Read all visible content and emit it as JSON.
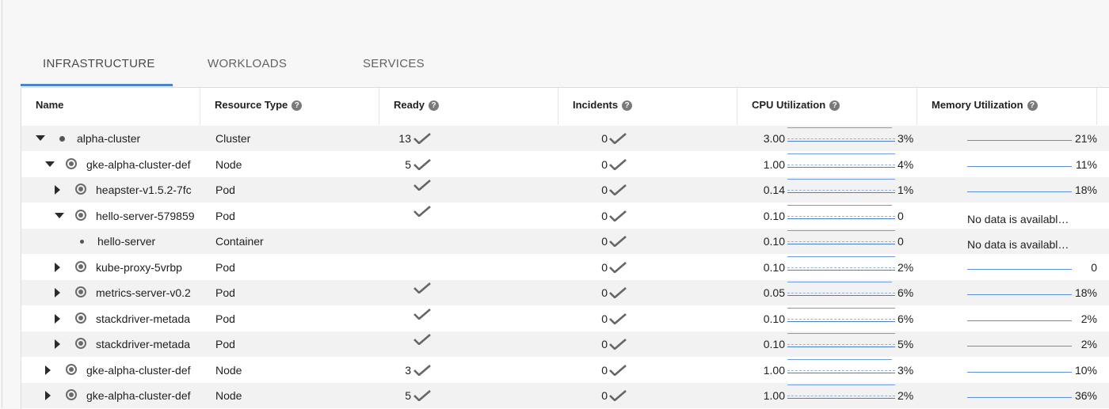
{
  "tabs": [
    {
      "label": "INFRASTRUCTURE",
      "active": true
    },
    {
      "label": "WORKLOADS",
      "active": false
    },
    {
      "label": "SERVICES",
      "active": false
    }
  ],
  "columns": {
    "name": "Name",
    "resource_type": "Resource Type",
    "ready": "Ready",
    "incidents": "Incidents",
    "cpu": "CPU Utilization",
    "memory": "Memory Utilization"
  },
  "rows": [
    {
      "name": "alpha-cluster",
      "type": "Cluster",
      "ready": "13",
      "ready_check": true,
      "incidents": "0",
      "cpu_value": "3.00",
      "cpu_pct": "3%",
      "mem": "21%",
      "level": 0,
      "expander": "down",
      "icon": "dot"
    },
    {
      "name": "gke-alpha-cluster-def",
      "type": "Node",
      "ready": "5",
      "ready_check": true,
      "incidents": "0",
      "cpu_value": "1.00",
      "cpu_pct": "4%",
      "mem": "11%",
      "level": 1,
      "expander": "down",
      "icon": "ring"
    },
    {
      "name": "heapster-v1.5.2-7fc",
      "type": "Pod",
      "ready": "",
      "ready_check": true,
      "incidents": "0",
      "cpu_value": "0.14",
      "cpu_pct": "1%",
      "mem": "18%",
      "level": 2,
      "expander": "right",
      "icon": "ring"
    },
    {
      "name": "hello-server-579859",
      "type": "Pod",
      "ready": "",
      "ready_check": true,
      "incidents": "0",
      "cpu_value": "0.10",
      "cpu_pct": "0",
      "mem": "No data is availabl…",
      "level": 2,
      "expander": "down",
      "icon": "ring"
    },
    {
      "name": "hello-server",
      "type": "Container",
      "ready": "",
      "ready_check": false,
      "incidents": "0",
      "cpu_value": "0.10",
      "cpu_pct": "0",
      "mem": "No data is availabl…",
      "level": 3,
      "expander": "",
      "icon": "small-dot"
    },
    {
      "name": "kube-proxy-5vrbp",
      "type": "Pod",
      "ready": "",
      "ready_check": false,
      "incidents": "0",
      "cpu_value": "0.10",
      "cpu_pct": "2%",
      "mem": "0",
      "level": 2,
      "expander": "right",
      "icon": "ring"
    },
    {
      "name": "metrics-server-v0.2",
      "type": "Pod",
      "ready": "",
      "ready_check": true,
      "incidents": "0",
      "cpu_value": "0.05",
      "cpu_pct": "6%",
      "mem": "18%",
      "level": 2,
      "expander": "right",
      "icon": "ring"
    },
    {
      "name": "stackdriver-metada",
      "type": "Pod",
      "ready": "",
      "ready_check": true,
      "incidents": "0",
      "cpu_value": "0.10",
      "cpu_pct": "6%",
      "mem": "2%",
      "level": 2,
      "expander": "right",
      "icon": "ring"
    },
    {
      "name": "stackdriver-metada",
      "type": "Pod",
      "ready": "",
      "ready_check": true,
      "incidents": "0",
      "cpu_value": "0.10",
      "cpu_pct": "5%",
      "mem": "2%",
      "level": 2,
      "expander": "right",
      "icon": "ring"
    },
    {
      "name": "gke-alpha-cluster-def",
      "type": "Node",
      "ready": "3",
      "ready_check": true,
      "incidents": "0",
      "cpu_value": "1.00",
      "cpu_pct": "3%",
      "mem": "10%",
      "level": 1,
      "expander": "right",
      "icon": "ring"
    },
    {
      "name": "gke-alpha-cluster-def",
      "type": "Node",
      "ready": "5",
      "ready_check": true,
      "incidents": "0",
      "cpu_value": "1.00",
      "cpu_pct": "2%",
      "mem": "36%",
      "level": 1,
      "expander": "right",
      "icon": "ring"
    }
  ],
  "colors": {
    "accent": "#4a86c5",
    "sparkline": "#5b8fd8",
    "row_shade": "#f2f2f2"
  }
}
